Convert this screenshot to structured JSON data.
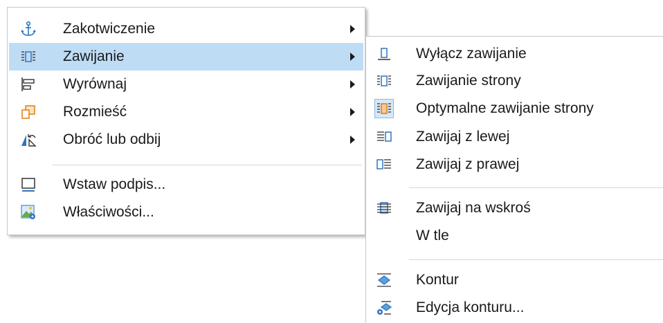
{
  "main_menu": {
    "items": [
      {
        "icon": "anchor-icon",
        "label": "Zakotwiczenie",
        "submenu": true
      },
      {
        "icon": "wrap-icon",
        "label": "Zawijanie",
        "submenu": true
      },
      {
        "icon": "align-icon",
        "label": "Wyrównaj",
        "submenu": true
      },
      {
        "icon": "arrange-icon",
        "label": "Rozmieść",
        "submenu": true
      },
      {
        "icon": "rotate-flip-icon",
        "label": "Obróć lub odbij",
        "submenu": true
      },
      {
        "icon": "caption-icon",
        "label": "Wstaw podpis..."
      },
      {
        "icon": "properties-icon",
        "label": "Właściwości..."
      }
    ],
    "highlighted": "Zawijanie"
  },
  "sub_menu": {
    "items": [
      {
        "icon": "wrap-off-icon",
        "label": "Wyłącz zawijanie"
      },
      {
        "icon": "page-wrap-icon",
        "label": "Zawijanie strony"
      },
      {
        "icon": "optimal-page-wrap-icon",
        "label": "Optymalne zawijanie strony",
        "selected": true
      },
      {
        "icon": "wrap-left-icon",
        "label": "Zawijaj z lewej"
      },
      {
        "icon": "wrap-right-icon",
        "label": "Zawijaj z prawej"
      },
      {
        "icon": "wrap-through-icon",
        "label": "Zawijaj na wskroś"
      },
      {
        "icon": "",
        "label": "W tle"
      },
      {
        "icon": "contour-icon",
        "label": "Kontur"
      },
      {
        "icon": "edit-contour-icon",
        "label": "Edycja konturu..."
      }
    ]
  },
  "colors": {
    "highlight": "#bfdcf5",
    "icon_blue": "#2f74c0",
    "icon_orange": "#e07b13"
  }
}
